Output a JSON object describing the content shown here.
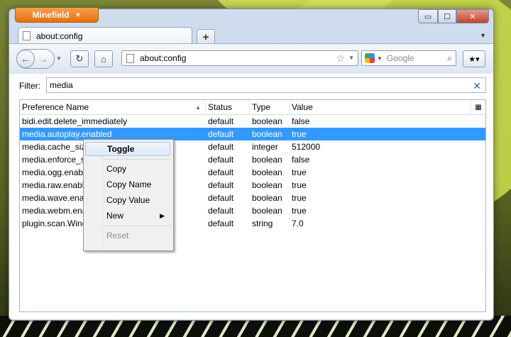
{
  "app": {
    "menu_button_label": "Minefield"
  },
  "window_controls": {
    "minimize": "▭",
    "maximize": "☐",
    "close": "✕"
  },
  "tab": {
    "title": "about:config",
    "new_tab_label": "+"
  },
  "navbar": {
    "url": "about:config",
    "search_placeholder": "Google",
    "back_glyph": "←",
    "forward_glyph": "→",
    "reload_glyph": "↻",
    "home_glyph": "⌂"
  },
  "filter": {
    "label": "Filter:",
    "value": "media",
    "clear_glyph": "✕"
  },
  "table": {
    "columns": [
      "Preference Name",
      "Status",
      "Type",
      "Value"
    ],
    "rows": [
      {
        "name": "bidi.edit.delete_immediately",
        "status": "default",
        "type": "boolean",
        "value": "false"
      },
      {
        "name": "media.autoplay.enabled",
        "status": "default",
        "type": "boolean",
        "value": "true",
        "selected": true
      },
      {
        "name": "media.cache_size",
        "status": "default",
        "type": "integer",
        "value": "512000"
      },
      {
        "name": "media.enforce_sa",
        "status": "default",
        "type": "boolean",
        "value": "false"
      },
      {
        "name": "media.ogg.enabl",
        "status": "default",
        "type": "boolean",
        "value": "true"
      },
      {
        "name": "media.raw.enable",
        "status": "default",
        "type": "boolean",
        "value": "true"
      },
      {
        "name": "media.wave.enab",
        "status": "default",
        "type": "boolean",
        "value": "true"
      },
      {
        "name": "media.webm.ena",
        "status": "default",
        "type": "boolean",
        "value": "true"
      },
      {
        "name": "plugin.scan.Winc",
        "status": "default",
        "type": "string",
        "value": "7.0"
      }
    ]
  },
  "context_menu": {
    "items": [
      "Toggle",
      "Copy",
      "Copy Name",
      "Copy Value",
      "New",
      "Reset"
    ],
    "highlighted": "Toggle",
    "disabled": [
      "Reset"
    ]
  },
  "colors": {
    "selection": "#3399ff",
    "app_button": "#e5700f"
  }
}
